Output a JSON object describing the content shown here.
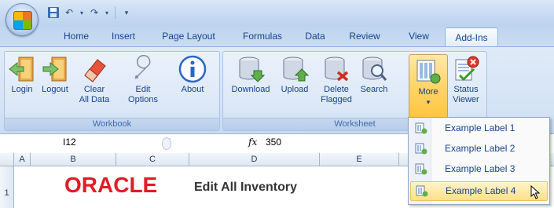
{
  "qat": {
    "icons": [
      "save-icon",
      "undo-icon",
      "redo-icon",
      "customize-icon"
    ]
  },
  "tabs": [
    "Home",
    "Insert",
    "Page Layout",
    "Formulas",
    "Data",
    "Review",
    "View",
    "Add-Ins"
  ],
  "ribbon": {
    "workbook": {
      "label": "Workbook",
      "buttons": [
        {
          "line1": "Login",
          "line2": ""
        },
        {
          "line1": "Logout",
          "line2": ""
        },
        {
          "line1": "Clear",
          "line2": "All Data"
        },
        {
          "line1": "Edit",
          "line2": "Options"
        },
        {
          "line1": "About",
          "line2": ""
        }
      ]
    },
    "worksheet": {
      "label": "Worksheet",
      "buttons": [
        {
          "line1": "Download",
          "line2": ""
        },
        {
          "line1": "Upload",
          "line2": ""
        },
        {
          "line1": "Delete",
          "line2": "Flagged"
        },
        {
          "line1": "Search",
          "line2": ""
        },
        {
          "line1": "More",
          "line2": "▾"
        },
        {
          "line1": "Status",
          "line2": "Viewer"
        }
      ]
    }
  },
  "formula_bar": {
    "cell_ref": "I12",
    "fx_symbol": "fx",
    "value": "350"
  },
  "columns": [
    "A",
    "B",
    "C",
    "D",
    "E"
  ],
  "rows": [
    "1"
  ],
  "sheet": {
    "logo_text": "ORACLE",
    "title": "Edit All Inventory"
  },
  "menu": {
    "items": [
      "Example Label 1",
      "Example Label 2",
      "Example Label 3",
      "Example Label 4"
    ]
  },
  "colors": {
    "accent": "#15428b",
    "oracle_red": "#e31b23",
    "hover": "#ffe08a"
  }
}
